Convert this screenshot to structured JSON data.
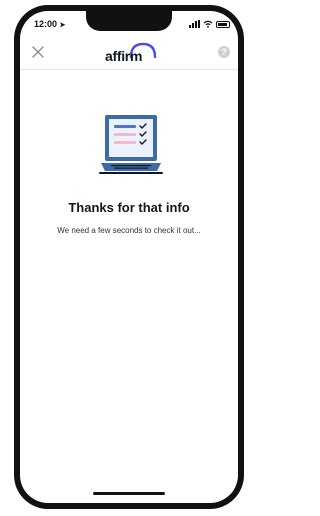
{
  "status_bar": {
    "time": "12:00"
  },
  "header": {
    "logo_text": "affirm",
    "help_label": "?"
  },
  "content": {
    "title": "Thanks for that info",
    "subtitle": "We need a few seconds to check it out..."
  },
  "colors": {
    "brand_dark": "#101820",
    "logo_arc": "#4a4af4",
    "laptop_blue": "#3f6aa8",
    "checklist_pink": "#f4b8c8",
    "checklist_blue": "#4f74c8"
  }
}
